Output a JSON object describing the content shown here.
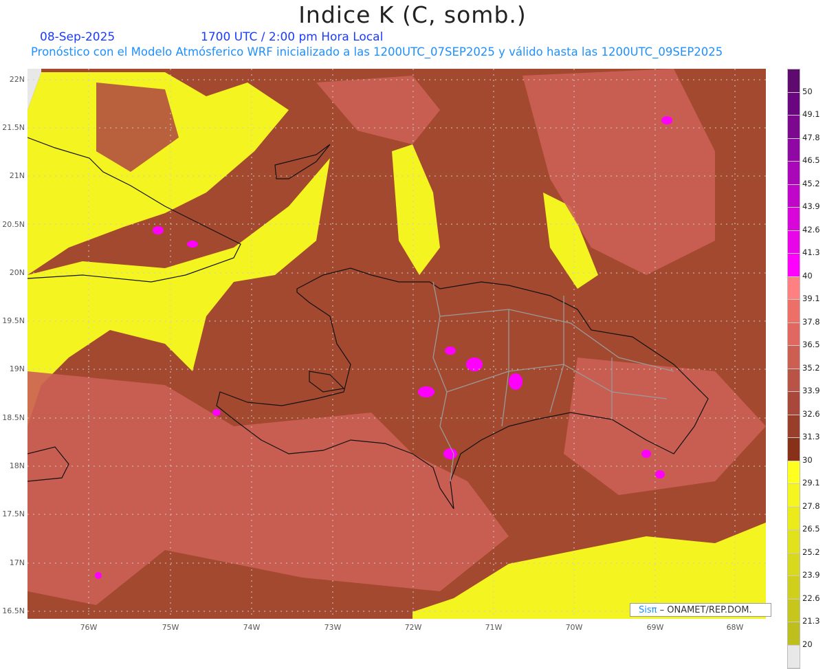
{
  "title": "Indice K (C, somb.)",
  "date": "08-Sep-2025",
  "time": "1700 UTC / 2:00 pm Hora Local",
  "model_line": "Pronóstico con el Modelo Atmósferico WRF inicializado a las 1200UTC_07SEP2025 y válido hasta las  1200UTC_09SEP2025",
  "lat_ticks": [
    "22N",
    "21.5N",
    "21N",
    "20.5N",
    "20N",
    "19.5N",
    "19N",
    "18.5N",
    "18N",
    "17.5N",
    "17N",
    "16.5N"
  ],
  "lon_ticks": [
    "76W",
    "75W",
    "74W",
    "73W",
    "72W",
    "71W",
    "70W",
    "69W",
    "68W"
  ],
  "legend": {
    "labels": [
      "50",
      "49.1",
      "47.8",
      "46.5",
      "45.2",
      "43.9",
      "42.6",
      "41.3",
      "40",
      "39.1",
      "37.8",
      "36.5",
      "35.2",
      "33.9",
      "32.6",
      "31.3",
      "30",
      "29.1",
      "27.8",
      "26.5",
      "25.2",
      "23.9",
      "22.6",
      "21.3",
      "20"
    ],
    "colors": [
      "#5e0a6e",
      "#6a0680",
      "#7d0890",
      "#9008a4",
      "#a808b8",
      "#c006c8",
      "#d806d8",
      "#e806e8",
      "#ff00ff",
      "#ff8080",
      "#ec7068",
      "#e06860",
      "#cc5e52",
      "#b95345",
      "#a8473a",
      "#9a3e2c",
      "#883018",
      "#ffff20",
      "#f5f520",
      "#ebeb1c",
      "#e2e21c",
      "#d8d81c",
      "#d0d01c",
      "#c6c61c",
      "#bebe1c",
      "#e8e8e8"
    ]
  },
  "credit": {
    "brand": "Sisπ",
    "text": " – ONAMET/REP.DOM."
  }
}
